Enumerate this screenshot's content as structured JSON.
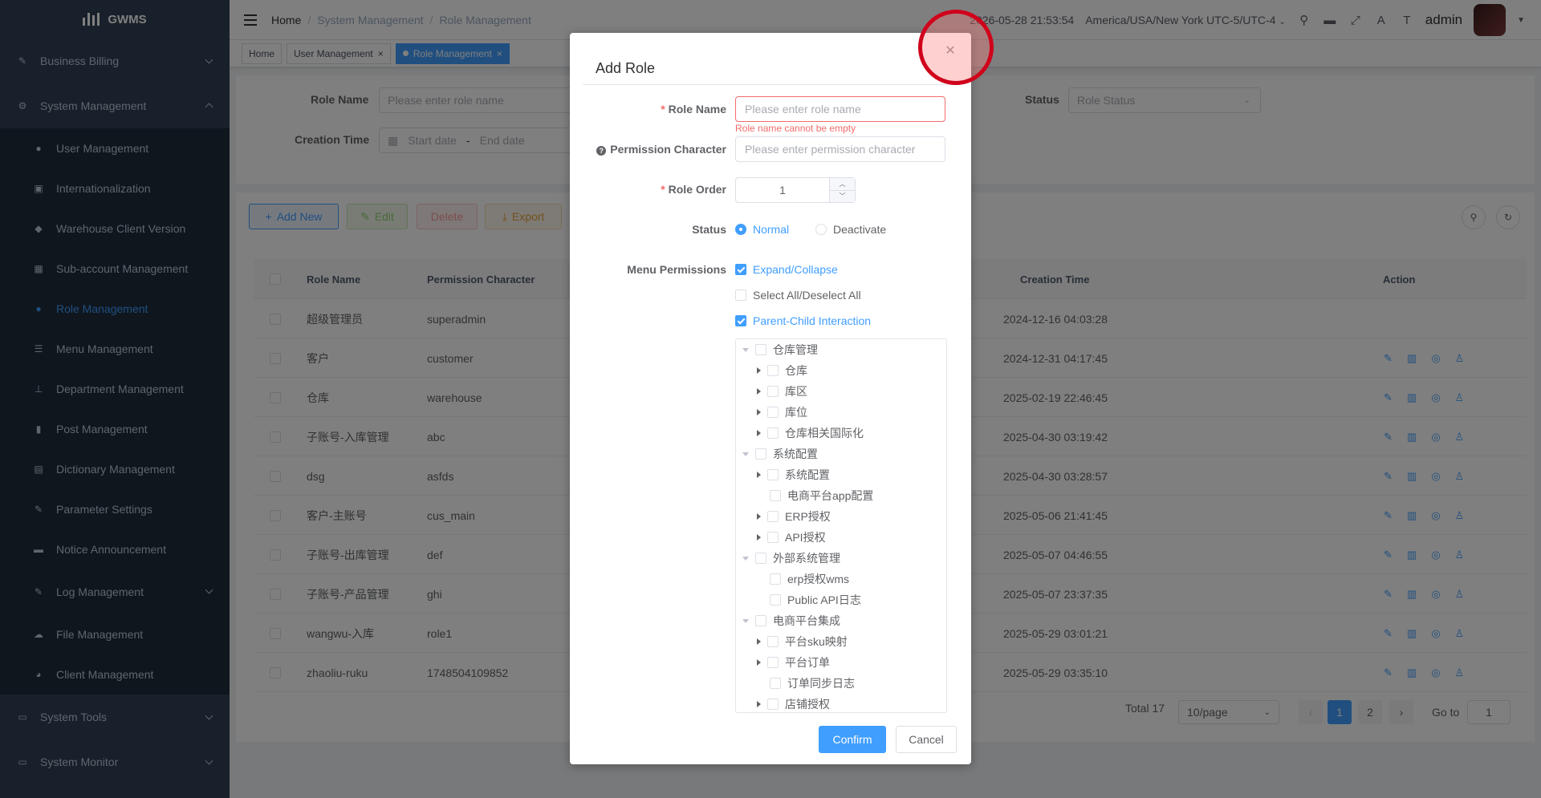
{
  "app": {
    "logo_text": "GWMS"
  },
  "sidebar": {
    "groups": [
      {
        "label": "Business Billing",
        "icon": "billing-icon"
      },
      {
        "label": "System Management",
        "icon": "gear-icon"
      }
    ],
    "sub_items": [
      {
        "label": "User Management",
        "icon": "user-icon"
      },
      {
        "label": "Internationalization",
        "icon": "language-icon"
      },
      {
        "label": "Warehouse Client Version",
        "icon": "android-icon"
      },
      {
        "label": "Sub-account Management",
        "icon": "grid-icon"
      },
      {
        "label": "Role Management",
        "icon": "role-icon"
      },
      {
        "label": "Menu Management",
        "icon": "list-icon"
      },
      {
        "label": "Department Management",
        "icon": "tree-icon"
      },
      {
        "label": "Post Management",
        "icon": "post-icon"
      },
      {
        "label": "Dictionary Management",
        "icon": "dictionary-icon"
      },
      {
        "label": "Parameter Settings",
        "icon": "edit-icon"
      },
      {
        "label": "Notice Announcement",
        "icon": "message-icon"
      },
      {
        "label": "Log Management",
        "icon": "log-icon"
      },
      {
        "label": "File Management",
        "icon": "cloud-icon"
      },
      {
        "label": "Client Management",
        "icon": "client-icon"
      }
    ],
    "bottom_groups": [
      {
        "label": "System Tools",
        "icon": "tools-icon"
      },
      {
        "label": "System Monitor",
        "icon": "monitor-icon"
      }
    ]
  },
  "topbar": {
    "breadcrumb": [
      "Home",
      "System Management",
      "Role Management"
    ],
    "datetime": "2026-05-28 21:53:54",
    "timezone": "America/USA/New York UTC-5/UTC-4",
    "username": "admin"
  },
  "tags": [
    {
      "label": "Home"
    },
    {
      "label": "User Management"
    },
    {
      "label": "Role Management"
    }
  ],
  "search": {
    "role_name_label": "Role Name",
    "role_name_placeholder": "Please enter role name",
    "status_label": "Status",
    "status_placeholder": "Role Status",
    "creation_time_label": "Creation Time",
    "start_placeholder": "Start date",
    "range_sep": "-",
    "end_placeholder": "End date"
  },
  "toolbar": {
    "add": "Add New",
    "edit": "Edit",
    "delete": "Delete",
    "export": "Export"
  },
  "table": {
    "headers": {
      "role_name": "Role Name",
      "permission": "Permission Character",
      "creation_time": "Creation Time",
      "action": "Action"
    },
    "rows": [
      {
        "name": "超级管理员",
        "perm": "superadmin",
        "time": "2024-12-16 04:03:28",
        "actions": false
      },
      {
        "name": "客户",
        "perm": "customer",
        "time": "2024-12-31 04:17:45",
        "actions": true
      },
      {
        "name": "仓库",
        "perm": "warehouse",
        "time": "2025-02-19 22:46:45",
        "actions": true
      },
      {
        "name": "子账号-入库管理",
        "perm": "abc",
        "time": "2025-04-30 03:19:42",
        "actions": true
      },
      {
        "name": "dsg",
        "perm": "asfds",
        "time": "2025-04-30 03:28:57",
        "actions": true
      },
      {
        "name": "客户-主账号",
        "perm": "cus_main",
        "time": "2025-05-06 21:41:45",
        "actions": true
      },
      {
        "name": "子账号-出库管理",
        "perm": "def",
        "time": "2025-05-07 04:46:55",
        "actions": true
      },
      {
        "name": "子账号-产品管理",
        "perm": "ghi",
        "time": "2025-05-07 23:37:35",
        "actions": true
      },
      {
        "name": "wangwu-入库",
        "perm": "role1",
        "time": "2025-05-29 03:01:21",
        "actions": true
      },
      {
        "name": "zhaoliu-ruku",
        "perm": "1748504109852",
        "time": "2025-05-29 03:35:10",
        "actions": true
      }
    ]
  },
  "pagination": {
    "total": "Total 17",
    "page_size": "10/page",
    "pages": [
      "1",
      "2"
    ],
    "goto_label": "Go to",
    "goto_value": "1"
  },
  "dialog": {
    "title": "Add Role",
    "role_name_label": "Role Name",
    "role_name_placeholder": "Please enter role name",
    "role_name_error": "Role name cannot be empty",
    "permission_label": "Permission Character",
    "permission_placeholder": "Please enter permission character",
    "role_order_label": "Role Order",
    "role_order_value": "1",
    "status_label": "Status",
    "status_normal": "Normal",
    "status_deactivate": "Deactivate",
    "menu_permissions_label": "Menu Permissions",
    "expand_collapse": "Expand/Collapse",
    "select_all": "Select All/Deselect All",
    "parent_child": "Parent-Child Interaction",
    "tree": [
      {
        "label": "仓库管理",
        "level": 0,
        "caret": "down"
      },
      {
        "label": "仓库",
        "level": 1,
        "caret": "right"
      },
      {
        "label": "库区",
        "level": 1,
        "caret": "right"
      },
      {
        "label": "库位",
        "level": 1,
        "caret": "right"
      },
      {
        "label": "仓库相关国际化",
        "level": 1,
        "caret": "right"
      },
      {
        "label": "系统配置",
        "level": 0,
        "caret": "down"
      },
      {
        "label": "系统配置",
        "level": 1,
        "caret": "right"
      },
      {
        "label": "电商平台app配置",
        "level": 1,
        "caret": "none"
      },
      {
        "label": "ERP授权",
        "level": 1,
        "caret": "right"
      },
      {
        "label": "API授权",
        "level": 1,
        "caret": "right"
      },
      {
        "label": "外部系统管理",
        "level": 0,
        "caret": "down"
      },
      {
        "label": "erp授权wms",
        "level": 1,
        "caret": "none"
      },
      {
        "label": "Public API日志",
        "level": 1,
        "caret": "none"
      },
      {
        "label": "电商平台集成",
        "level": 0,
        "caret": "down"
      },
      {
        "label": "平台sku映射",
        "level": 1,
        "caret": "right"
      },
      {
        "label": "平台订单",
        "level": 1,
        "caret": "right"
      },
      {
        "label": "订单同步日志",
        "level": 1,
        "caret": "none"
      },
      {
        "label": "店铺授权",
        "level": 1,
        "caret": "right"
      }
    ],
    "confirm": "Confirm",
    "cancel": "Cancel"
  }
}
